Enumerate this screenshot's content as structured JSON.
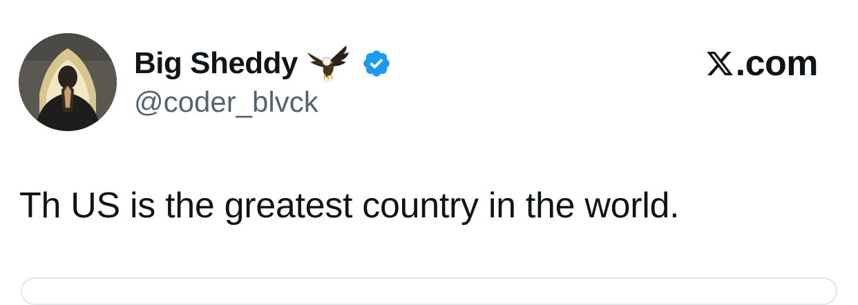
{
  "tweet": {
    "author": {
      "display_name": "Big Sheddy",
      "handle": "@coder_blvck",
      "name_emoji": "eagle-icon",
      "verified": true,
      "verified_color": "#1d9bf0",
      "avatar": "avatar-icon"
    },
    "brand": {
      "text": ".com",
      "logo": "x-logo-icon"
    },
    "text": "Th US is the greatest country in the world."
  },
  "colors": {
    "text_primary": "#0f1419",
    "text_secondary": "#536471",
    "verified_blue": "#1d9bf0",
    "background": "#ffffff"
  }
}
